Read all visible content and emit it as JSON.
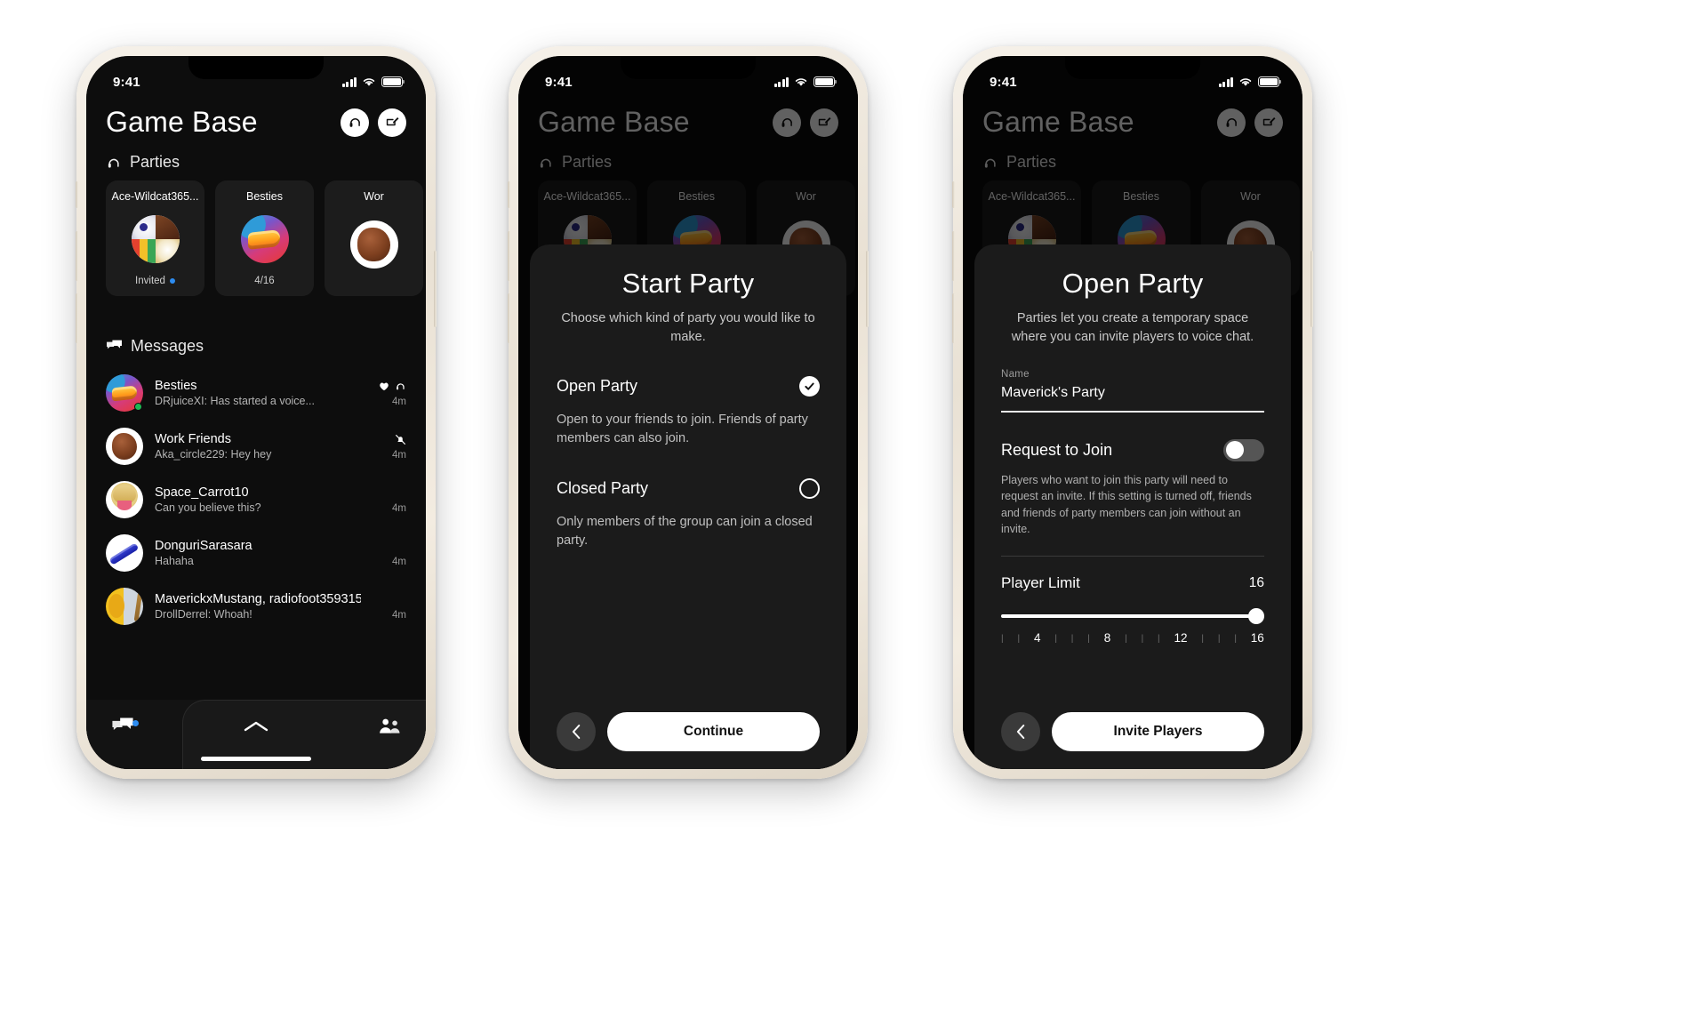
{
  "status_bar": {
    "time": "9:41",
    "signal_icon": "cellular-bars-icon",
    "wifi_icon": "wifi-icon",
    "battery_icon": "battery-icon"
  },
  "app": {
    "title": "Game Base",
    "header_icons": [
      {
        "name": "headset-icon",
        "label": "Parties"
      },
      {
        "name": "compose-message-icon",
        "label": "New message"
      }
    ],
    "parties_section": {
      "icon": "headset-icon",
      "label": "Parties",
      "cards": [
        {
          "name": "Ace-Wildcat365...",
          "meta": "Invited",
          "has_dot": true,
          "avatar": "quad-avatar"
        },
        {
          "name": "Besties",
          "meta": "4/16",
          "has_dot": false,
          "avatar": "bread-avatar"
        },
        {
          "name": "Wor",
          "meta": "",
          "has_dot": false,
          "avatar": "meat-avatar"
        }
      ]
    },
    "messages_section": {
      "icon": "messages-bubbles-icon",
      "label": "Messages",
      "items": [
        {
          "name": "Besties",
          "preview": "DRjuiceXI: Has started a voice...",
          "time": "4m",
          "avatar": "bread-avatar",
          "online": true,
          "icons": [
            "heart-icon",
            "headset-icon"
          ]
        },
        {
          "name": "Work Friends",
          "preview": "Aka_circle229: Hey hey",
          "time": "4m",
          "avatar": "meat-avatar",
          "online": false,
          "icons": [
            "muted-bell-icon"
          ]
        },
        {
          "name": "Space_Carrot10",
          "preview": "Can you believe this?",
          "time": "4m",
          "avatar": "cat-avatar",
          "online": false,
          "icons": []
        },
        {
          "name": "DonguriSarasara",
          "preview": "Hahaha",
          "time": "4m",
          "avatar": "board-avatar",
          "online": false,
          "icons": []
        },
        {
          "name": "MaverickxMustang, radiofoot359315",
          "preview": "DrollDerrel: Whoah!",
          "time": "4m",
          "avatar": "lion-avatar",
          "online": false,
          "icons": []
        }
      ]
    },
    "tabbar": [
      {
        "name": "tab-messages",
        "icon": "messages-bubbles-icon",
        "badge": true
      },
      {
        "name": "tab-expand",
        "icon": "chevron-up-icon",
        "badge": false
      },
      {
        "name": "tab-friends",
        "icon": "people-icon",
        "badge": false
      }
    ]
  },
  "start_party_sheet": {
    "title": "Start Party",
    "subtitle": "Choose which kind of party you would like to make.",
    "options": [
      {
        "label": "Open Party",
        "selected": true,
        "description": "Open to your friends to join. Friends of party members can also join."
      },
      {
        "label": "Closed Party",
        "selected": false,
        "description": "Only members of the group can join a closed party."
      }
    ],
    "back_icon": "chevron-left-icon",
    "primary_button": "Continue"
  },
  "open_party_sheet": {
    "title": "Open Party",
    "subtitle": "Parties let you create a temporary space where you can invite players to voice chat.",
    "name_field": {
      "label": "Name",
      "value": "Maverick's Party"
    },
    "request_to_join": {
      "label": "Request to Join",
      "enabled": false,
      "help": "Players who want to join this party will need to request an invite. If this setting is turned off, friends and friends of party members can join without an invite."
    },
    "player_limit": {
      "label": "Player Limit",
      "value": "16",
      "ticks": [
        "4",
        "8",
        "12",
        "16"
      ],
      "fill_percent": 100
    },
    "back_icon": "chevron-left-icon",
    "primary_button": "Invite Players"
  },
  "colors": {
    "accent_blue": "#2d8cf0",
    "online_green": "#1db954",
    "screen_bg": "#0d0d0d",
    "sheet_bg": "#1b1b1b",
    "primary_button_bg": "#ffffff"
  }
}
